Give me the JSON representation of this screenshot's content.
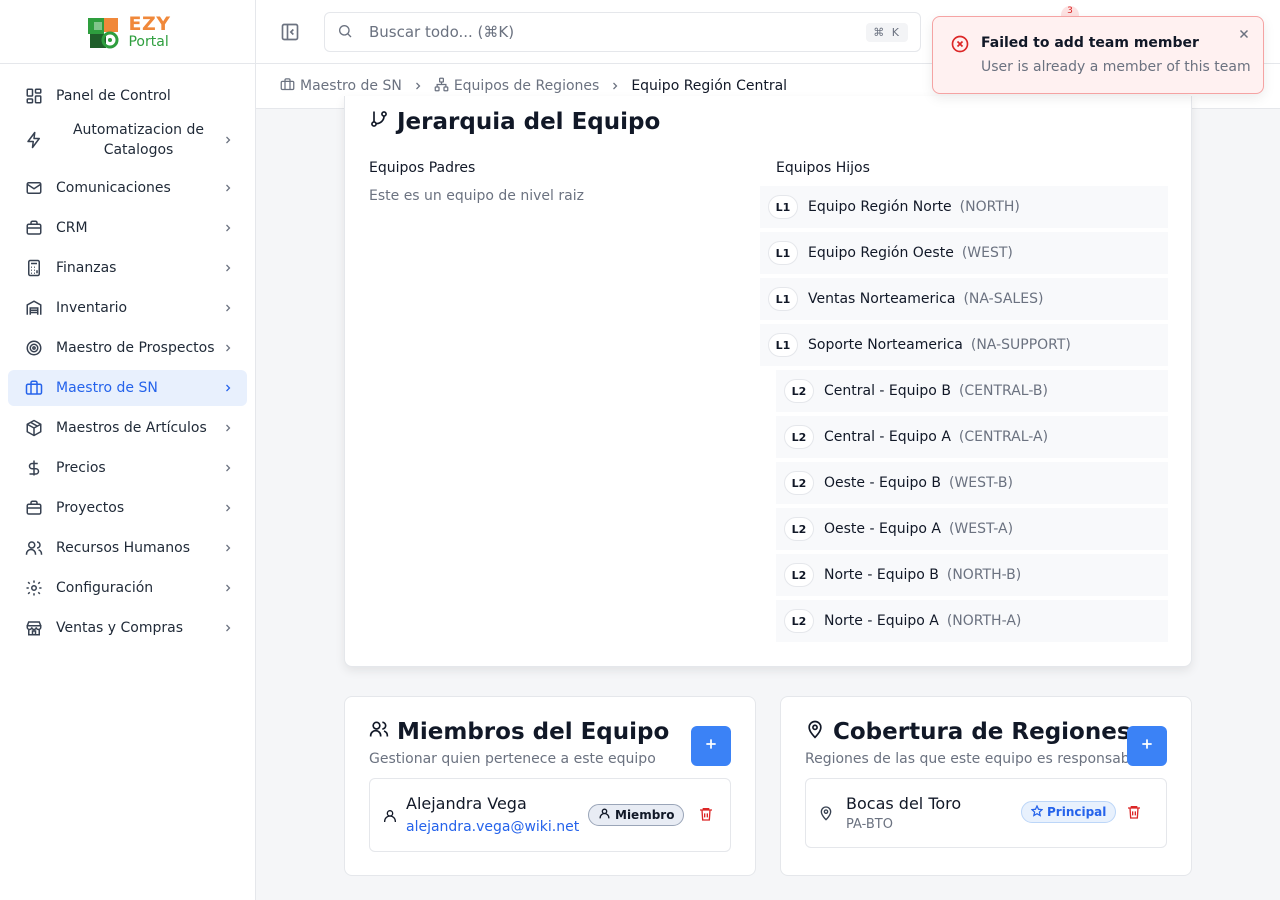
{
  "logo": {
    "line1": "EZY",
    "line2": "Portal"
  },
  "sidebar": {
    "items": [
      {
        "label": "Panel de Control",
        "icon": "dashboard-icon"
      },
      {
        "label": "Automatizacion de Catalogos",
        "icon": "lightning-icon"
      },
      {
        "label": "Comunicaciones",
        "icon": "mail-icon"
      },
      {
        "label": "CRM",
        "icon": "briefcase-icon"
      },
      {
        "label": "Finanzas",
        "icon": "calculator-icon"
      },
      {
        "label": "Inventario",
        "icon": "warehouse-icon"
      },
      {
        "label": "Maestro de Prospectos",
        "icon": "target-icon"
      },
      {
        "label": "Maestro de SN",
        "icon": "suitcase-icon",
        "active": true
      },
      {
        "label": "Maestros de Artículos",
        "icon": "box-icon"
      },
      {
        "label": "Precios",
        "icon": "dollar-icon"
      },
      {
        "label": "Proyectos",
        "icon": "briefcase-icon"
      },
      {
        "label": "Recursos Humanos",
        "icon": "users-icon"
      },
      {
        "label": "Configuración",
        "icon": "gear-icon"
      },
      {
        "label": "Ventas y Compras",
        "icon": "store-icon"
      }
    ]
  },
  "header": {
    "search_placeholder": "Buscar todo... (⌘K)",
    "search_shortcut": "⌘ K",
    "notification_count": "3"
  },
  "breadcrumb": {
    "items": [
      "Maestro de SN",
      "Equipos de Regiones"
    ],
    "current": "Equipo Región Central"
  },
  "hierarchy": {
    "title": "Jerarquia del Equipo",
    "parents_label": "Equipos Padres",
    "root_note": "Este es un equipo de nivel raiz",
    "children_label": "Equipos Hijos",
    "children": [
      {
        "level": "L1",
        "name": "Equipo Región Norte",
        "code": "(NORTH)"
      },
      {
        "level": "L1",
        "name": "Equipo Región Oeste",
        "code": "(WEST)"
      },
      {
        "level": "L1",
        "name": "Ventas Norteamerica",
        "code": "(NA-SALES)"
      },
      {
        "level": "L1",
        "name": "Soporte Norteamerica",
        "code": "(NA-SUPPORT)"
      },
      {
        "level": "L2",
        "name": "Central - Equipo B",
        "code": "(CENTRAL-B)"
      },
      {
        "level": "L2",
        "name": "Central - Equipo A",
        "code": "(CENTRAL-A)"
      },
      {
        "level": "L2",
        "name": "Oeste - Equipo B",
        "code": "(WEST-B)"
      },
      {
        "level": "L2",
        "name": "Oeste - Equipo A",
        "code": "(WEST-A)"
      },
      {
        "level": "L2",
        "name": "Norte - Equipo B",
        "code": "(NORTH-B)"
      },
      {
        "level": "L2",
        "name": "Norte - Equipo A",
        "code": "(NORTH-A)"
      }
    ]
  },
  "members": {
    "title": "Miembros del Equipo",
    "subtitle": "Gestionar quien pertenece a este equipo",
    "add_label": "+",
    "list": [
      {
        "name": "Alejandra Vega",
        "email": "alejandra.vega@wiki.net",
        "role": "Miembro"
      }
    ]
  },
  "coverage": {
    "title": "Cobertura de Regiones",
    "subtitle": "Regiones de las que este equipo es responsable",
    "add_label": "+",
    "list": [
      {
        "name": "Bocas del Toro",
        "code": "PA-BTO",
        "badge": "Principal"
      }
    ]
  },
  "toast": {
    "title": "Failed to add team member",
    "message": "User is already a member of this team"
  },
  "colors": {
    "primary": "#3b82f6",
    "active_bg": "#e8f0fd",
    "error": "#dc2626",
    "logo_orange": "#f0883a",
    "logo_green": "#2e9e3e"
  }
}
